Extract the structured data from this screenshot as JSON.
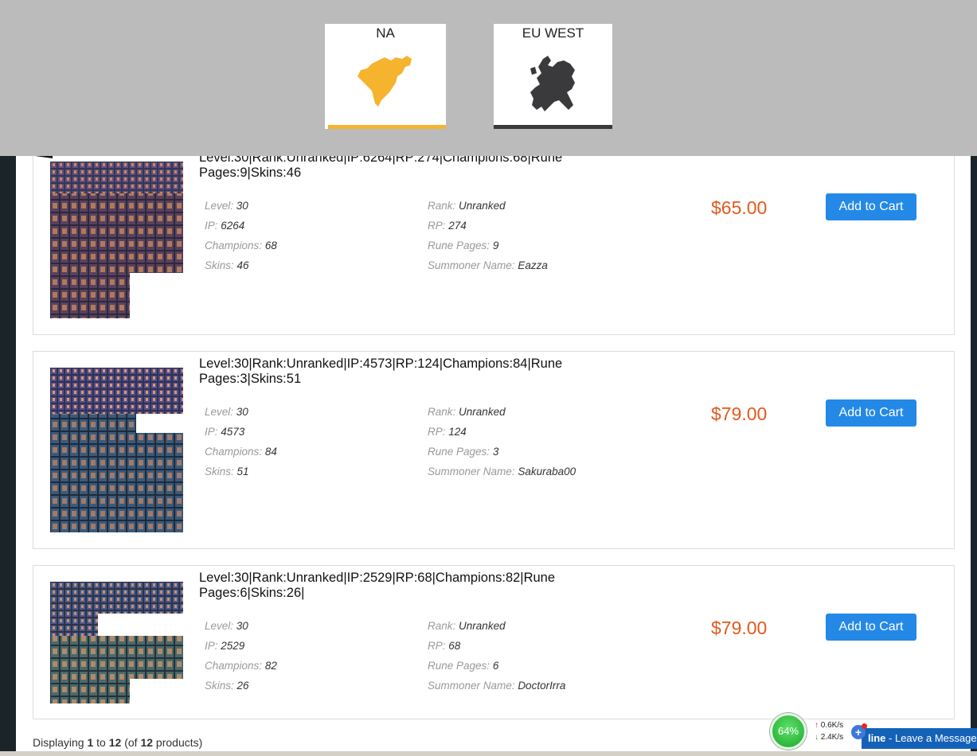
{
  "regions": [
    {
      "label": "NA",
      "color": "#f6b32e"
    },
    {
      "label": "EU WEST",
      "color": "#3a3a3c"
    }
  ],
  "products": [
    {
      "title": "Level:30|Rank:Unranked|IP:6264|RP:274|Champions:68|Rune Pages:9|Skins:46",
      "level": {
        "k": "Level:",
        "v": "30"
      },
      "rank": {
        "k": "Rank:",
        "v": "Unranked"
      },
      "ip": {
        "k": "IP:",
        "v": "6264"
      },
      "rp": {
        "k": "RP:",
        "v": "274"
      },
      "champions": {
        "k": "Champions:",
        "v": "68"
      },
      "rune_pages": {
        "k": "Rune Pages:",
        "v": "9"
      },
      "skins": {
        "k": "Skins:",
        "v": "46"
      },
      "summoner": {
        "k": "Summoner Name:",
        "v": "Eazza"
      },
      "price": "$65.00",
      "button": "Add to Cart"
    },
    {
      "title": "Level:30|Rank:Unranked|IP:4573|RP:124|Champions:84|Rune Pages:3|Skins:51",
      "level": {
        "k": "Level:",
        "v": "30"
      },
      "rank": {
        "k": "Rank:",
        "v": "Unranked"
      },
      "ip": {
        "k": "IP:",
        "v": "4573"
      },
      "rp": {
        "k": "RP:",
        "v": "124"
      },
      "champions": {
        "k": "Champions:",
        "v": "84"
      },
      "rune_pages": {
        "k": "Rune Pages:",
        "v": "3"
      },
      "skins": {
        "k": "Skins:",
        "v": "51"
      },
      "summoner": {
        "k": "Summoner Name:",
        "v": "Sakuraba00"
      },
      "price": "$79.00",
      "button": "Add to Cart"
    },
    {
      "title": "Level:30|Rank:Unranked|IP:2529|RP:68|Champions:82|Rune Pages:6|Skins:26|",
      "level": {
        "k": "Level:",
        "v": "30"
      },
      "rank": {
        "k": "Rank:",
        "v": "Unranked"
      },
      "ip": {
        "k": "IP:",
        "v": "2529"
      },
      "rp": {
        "k": "RP:",
        "v": "68"
      },
      "champions": {
        "k": "Champions:",
        "v": "82"
      },
      "rune_pages": {
        "k": "Rune Pages:",
        "v": "6"
      },
      "skins": {
        "k": "Skins:",
        "v": "26"
      },
      "summoner": {
        "k": "Summoner Name:",
        "v": "DoctorIrra"
      },
      "price": "$79.00",
      "button": "Add to Cart"
    }
  ],
  "pagination": {
    "prefix": "Displaying",
    "from": "1",
    "to_word": "to",
    "to": "12",
    "of_open": "(of",
    "total": "12",
    "suffix": "products)"
  },
  "widget": {
    "percent": "64%",
    "upload": "0.6K/s",
    "download": "2.4K/s",
    "plus": "+"
  },
  "chat": {
    "bold": "line",
    "text": " - Leave a Message"
  }
}
